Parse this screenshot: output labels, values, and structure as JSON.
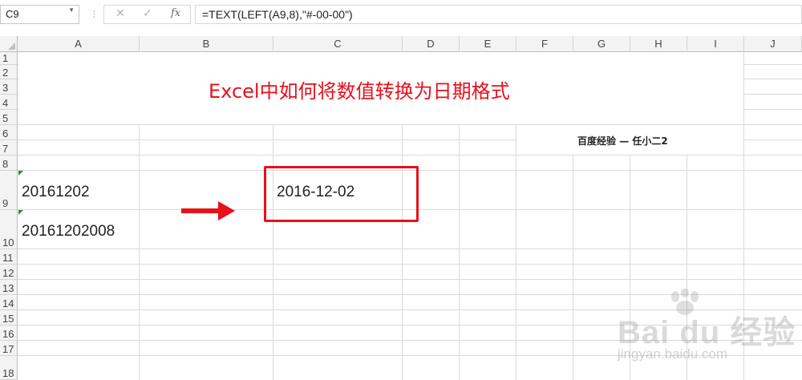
{
  "formula_bar": {
    "name_box": "C9",
    "separator": "⋮",
    "cancel_icon": "✕",
    "enter_icon": "✓",
    "fx_icon": "fx",
    "formula": "=TEXT(LEFT(A9,8),\"#-00-00\")"
  },
  "columns": [
    "A",
    "B",
    "C",
    "D",
    "E",
    "F",
    "G",
    "H",
    "I",
    "J"
  ],
  "rows": [
    "1",
    "2",
    "3",
    "4",
    "5",
    "6",
    "7",
    "8",
    "9",
    "10",
    "11",
    "12",
    "13",
    "14",
    "15",
    "16",
    "17",
    "18"
  ],
  "sheet": {
    "title": "Excel中如何将数值转换为日期格式",
    "credit": "百度经验 — 任小二2",
    "a9": "20161202",
    "a10": "20161202008",
    "c9": "2016-12-02"
  },
  "colors": {
    "highlight": "#e8101b",
    "accent_green": "#1f8f3a"
  },
  "watermark": {
    "logo": "Bai du 经验",
    "url": "jingyan.baidu.com"
  }
}
